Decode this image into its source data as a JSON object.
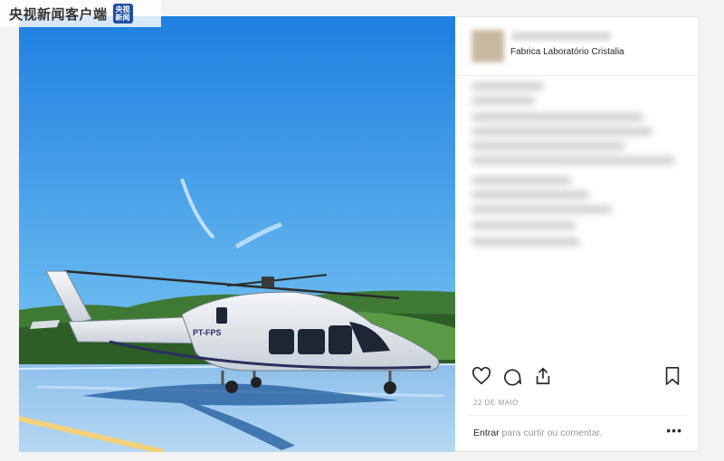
{
  "watermark": {
    "text": "央视新闻客户端",
    "logo_line1": "央视",
    "logo_line2": "新闻"
  },
  "photo": {
    "tail_number": "PT-FPS",
    "colors": {
      "sky_top": "#1c86e8",
      "sky_bottom": "#5fb6f2",
      "pad": "#9cc6ea",
      "hills": "#2f6b2a"
    }
  },
  "post": {
    "location": "Fabrica Laboratório Cristalia",
    "date": "22 DE MAIO",
    "login_prompt": {
      "link": "Entrar",
      "rest": " para curtir ou comentar."
    },
    "more_label": "•••",
    "action_icons": [
      "heart-icon",
      "comment-icon",
      "share-icon",
      "bookmark-icon"
    ]
  }
}
